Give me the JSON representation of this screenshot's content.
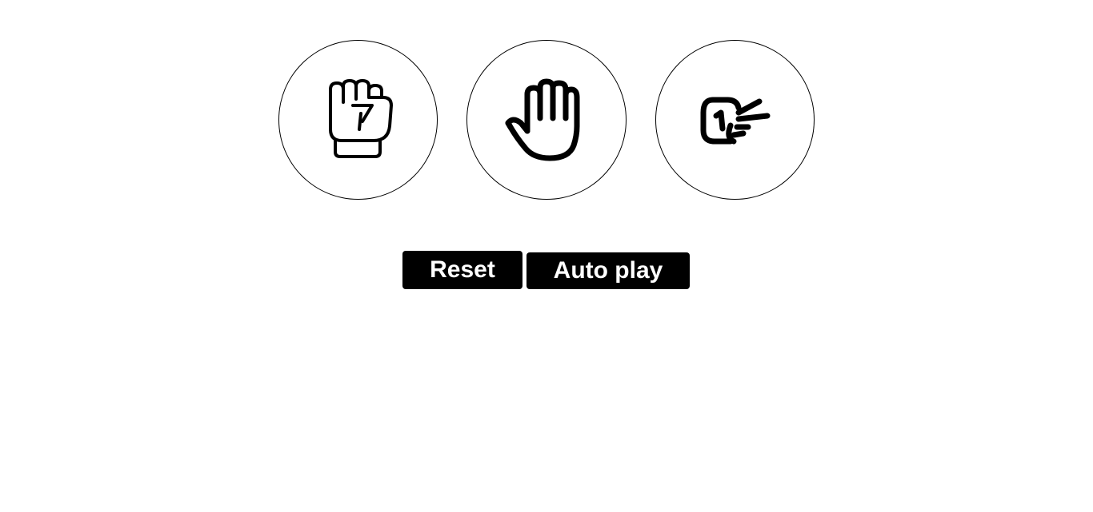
{
  "choices": [
    {
      "icon": "rock-fist-icon"
    },
    {
      "icon": "paper-hand-icon"
    },
    {
      "icon": "scissors-hand-icon"
    }
  ],
  "controls": {
    "reset_label": "Reset",
    "autoplay_label": "Auto play"
  },
  "colors": {
    "accent": "#000000",
    "background": "#ffffff"
  }
}
